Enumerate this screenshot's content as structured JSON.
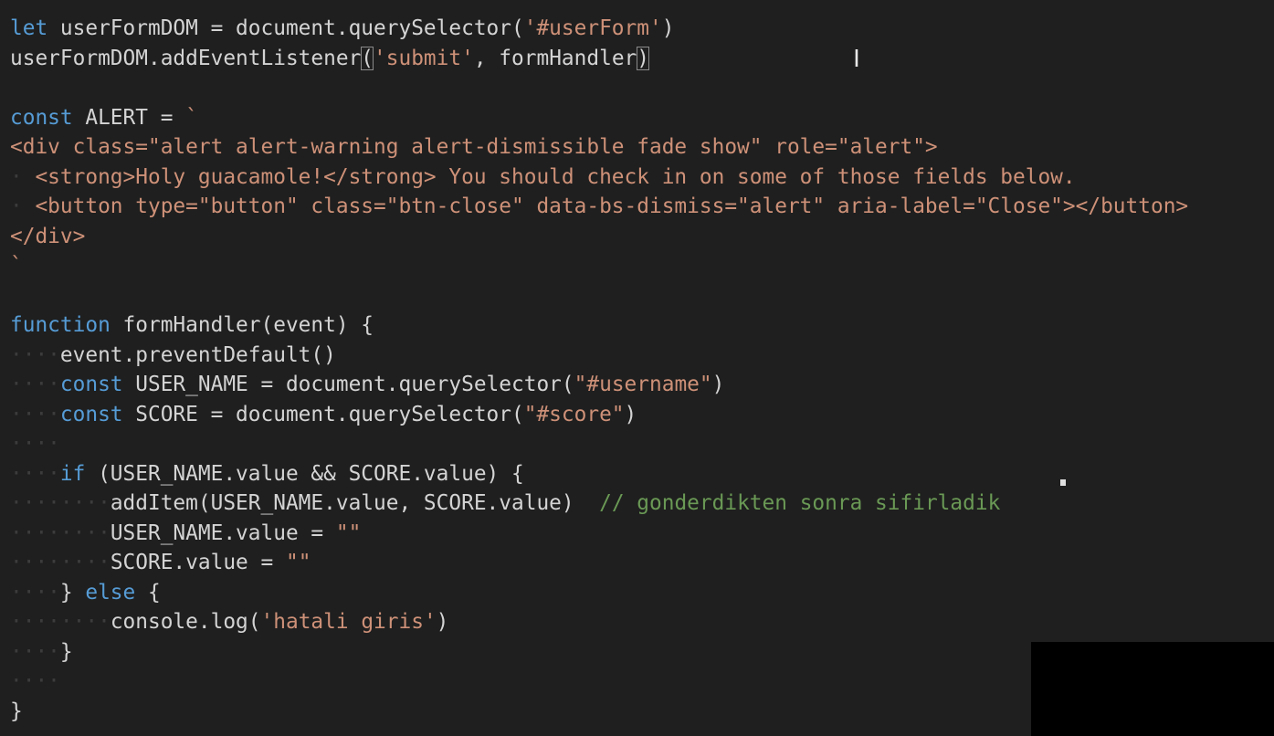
{
  "editor": {
    "lines": [
      [
        [
          "kw",
          "let"
        ],
        [
          "plain",
          " userFormDOM = document.querySelector("
        ],
        [
          "str",
          "'#userForm'"
        ],
        [
          "plain",
          ")"
        ]
      ],
      [
        [
          "plain",
          "userFormDOM.addEventListener"
        ],
        [
          "br",
          "("
        ],
        [
          "str",
          "'submit'"
        ],
        [
          "plain",
          ", formHandler"
        ],
        [
          "br",
          ")"
        ]
      ],
      [],
      [
        [
          "kw",
          "const"
        ],
        [
          "plain",
          " ALERT = "
        ],
        [
          "str",
          "`"
        ]
      ],
      [
        [
          "str",
          "<div class=\"alert alert-warning alert-dismissible fade show\" role=\"alert\">"
        ]
      ],
      [
        [
          "ws",
          "·"
        ],
        [
          "str",
          " <strong>Holy guacamole!</strong> You should check in on some of those fields below."
        ]
      ],
      [
        [
          "ws",
          "·"
        ],
        [
          "str",
          " <button type=\"button\" class=\"btn-close\" data-bs-dismiss=\"alert\" aria-label=\"Close\"></button>"
        ]
      ],
      [
        [
          "str",
          "</div>"
        ]
      ],
      [
        [
          "str",
          "`"
        ]
      ],
      [],
      [
        [
          "kw",
          "function"
        ],
        [
          "plain",
          " formHandler(event) {"
        ]
      ],
      [
        [
          "ws",
          "····"
        ],
        [
          "plain",
          "event.preventDefault()"
        ]
      ],
      [
        [
          "ws",
          "····"
        ],
        [
          "kw",
          "const"
        ],
        [
          "plain",
          " USER_NAME = document.querySelector("
        ],
        [
          "str",
          "\"#username\""
        ],
        [
          "plain",
          ")"
        ]
      ],
      [
        [
          "ws",
          "····"
        ],
        [
          "kw",
          "const"
        ],
        [
          "plain",
          " SCORE = document.querySelector("
        ],
        [
          "str",
          "\"#score\""
        ],
        [
          "plain",
          ")"
        ]
      ],
      [
        [
          "ws",
          "····"
        ]
      ],
      [
        [
          "ws",
          "····"
        ],
        [
          "kw",
          "if"
        ],
        [
          "plain",
          " (USER_NAME.value && SCORE.value) {"
        ]
      ],
      [
        [
          "ws",
          "········"
        ],
        [
          "plain",
          "addItem(USER_NAME.value, SCORE.value)  "
        ],
        [
          "com",
          "// gonderdikten sonra sifirladik"
        ]
      ],
      [
        [
          "ws",
          "········"
        ],
        [
          "plain",
          "USER_NAME.value = "
        ],
        [
          "str",
          "\"\""
        ]
      ],
      [
        [
          "ws",
          "········"
        ],
        [
          "plain",
          "SCORE.value = "
        ],
        [
          "str",
          "\"\""
        ]
      ],
      [
        [
          "ws",
          "····"
        ],
        [
          "plain",
          "} "
        ],
        [
          "kw",
          "else"
        ],
        [
          "plain",
          " {"
        ]
      ],
      [
        [
          "ws",
          "········"
        ],
        [
          "plain",
          "console.log("
        ],
        [
          "str",
          "'hatali giris'"
        ],
        [
          "plain",
          ")"
        ]
      ],
      [
        [
          "ws",
          "····"
        ],
        [
          "plain",
          "}"
        ]
      ],
      [
        [
          "ws",
          "····"
        ]
      ],
      [
        [
          "plain",
          "}"
        ]
      ]
    ]
  },
  "colors": {
    "background": "#1f1f1f",
    "keyword": "#569cd6",
    "string": "#ce9178",
    "comment": "#6a9955",
    "plain": "#d4d4d4"
  },
  "cursor": {
    "icon": "text-cursor-icon",
    "glyph": "I"
  }
}
